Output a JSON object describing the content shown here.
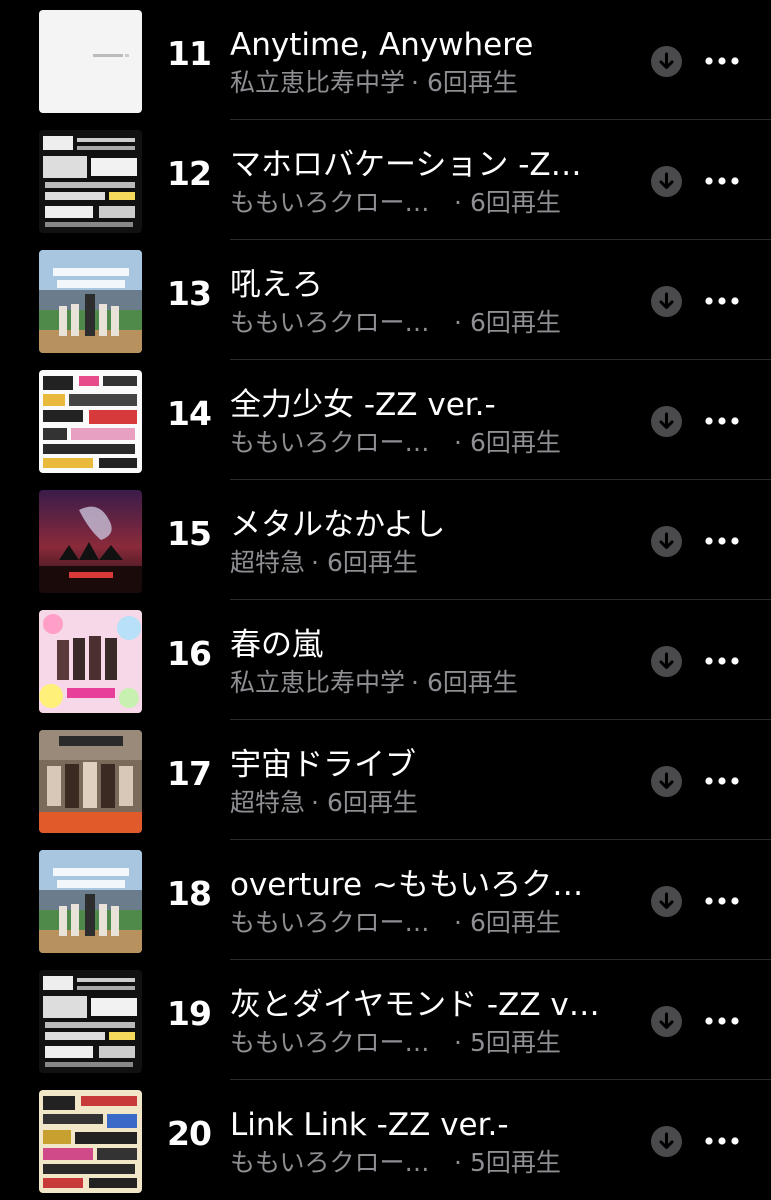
{
  "rows": [
    {
      "rank": "11",
      "title": "Anytime, Anywhere",
      "artist": "私立恵比寿中学",
      "plays": "6回再生",
      "art": "album-white"
    },
    {
      "rank": "12",
      "title": "マホロバケーション -Z…",
      "artist": "ももいろクロー…",
      "plays": "6回再生",
      "art": "album-zz2"
    },
    {
      "rank": "13",
      "title": "吼えろ",
      "artist": "ももいろクロー…",
      "plays": "6回再生",
      "art": "album-stadium"
    },
    {
      "rank": "14",
      "title": "全力少女 -ZZ ver.-",
      "artist": "ももいろクロー…",
      "plays": "6回再生",
      "art": "album-zz1"
    },
    {
      "rank": "15",
      "title": "メタルなかよし",
      "artist": "超特急",
      "plays": "6回再生",
      "art": "album-dragon"
    },
    {
      "rank": "16",
      "title": "春の嵐",
      "artist": "私立恵比寿中学",
      "plays": "6回再生",
      "art": "album-pink"
    },
    {
      "rank": "17",
      "title": "宇宙ドライブ",
      "artist": "超特急",
      "plays": "6回再生",
      "art": "album-space"
    },
    {
      "rank": "18",
      "title": "overture ~ももいろク…",
      "artist": "ももいろクロー…",
      "plays": "6回再生",
      "art": "album-stadium"
    },
    {
      "rank": "19",
      "title": "灰とダイヤモンド -ZZ v…",
      "artist": "ももいろクロー…",
      "plays": "5回再生",
      "art": "album-zz2"
    },
    {
      "rank": "20",
      "title": "Link Link -ZZ ver.-",
      "artist": "ももいろクロー…",
      "plays": "5回再生",
      "art": "album-zz3"
    }
  ],
  "separator": "·",
  "icons": {
    "download": "download-circle-icon",
    "more": "more-ellipsis-icon"
  },
  "colors": {
    "background": "#000000",
    "primary_text": "#ffffff",
    "secondary_text": "#8e8e93",
    "icon_circle": "#4a4a4c",
    "separator": "#2a2a2c"
  }
}
